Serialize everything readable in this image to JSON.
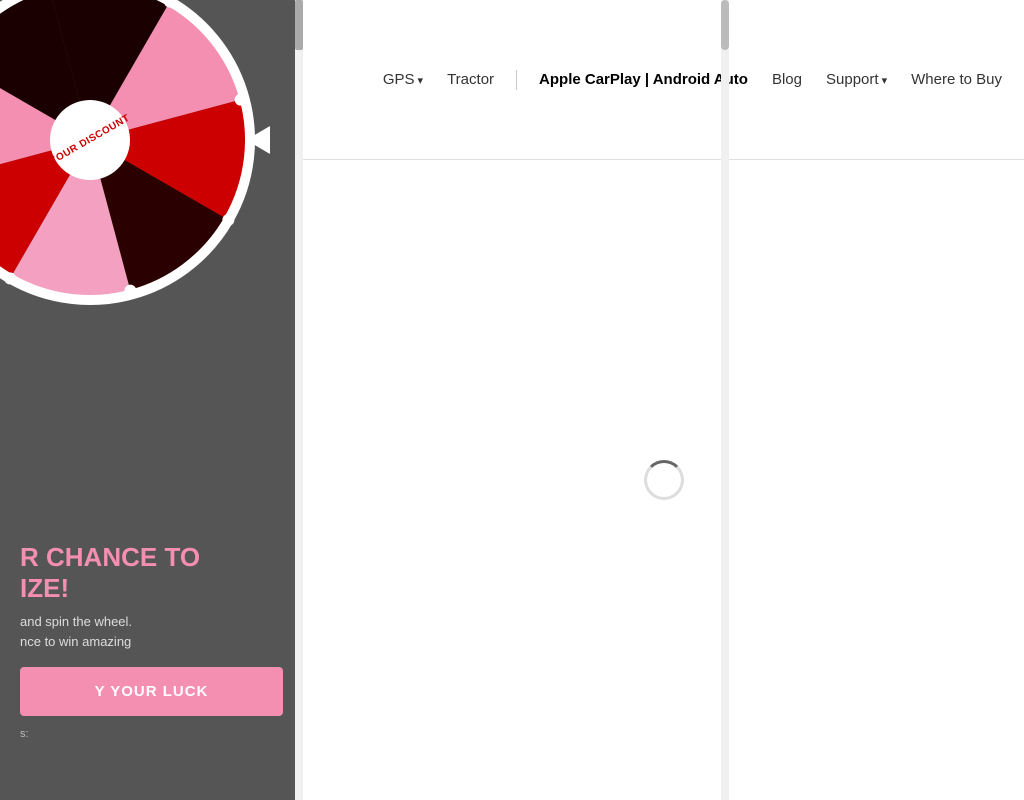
{
  "header": {
    "nav_items": [
      {
        "label": "GPS",
        "dropdown": true,
        "active": false
      },
      {
        "label": "Tractor",
        "dropdown": false,
        "active": false
      },
      {
        "label": "Apple CarPlay | Android Auto",
        "dropdown": false,
        "active": true
      },
      {
        "label": "Blog",
        "dropdown": false,
        "active": false
      },
      {
        "label": "Support",
        "dropdown": true,
        "active": false
      },
      {
        "label": "Where to Buy",
        "dropdown": false,
        "active": false
      }
    ]
  },
  "popup": {
    "wheel_label": "YOUR DISCOUNT",
    "heading_line1": "R CHANCE TO",
    "heading_highlight": "IZE",
    "heading_suffix": "!",
    "subtext_line1": "and spin the wheel.",
    "subtext_line2": "nce to win amazing",
    "button_label": "Y YOUR LUCK",
    "footer_text": "s:"
  },
  "wheel": {
    "segments": [
      {
        "color": "#1a0000",
        "angle": 0
      },
      {
        "color": "#f48fb1",
        "angle": 45
      },
      {
        "color": "#cc0000",
        "angle": 90
      },
      {
        "color": "#1a0000",
        "angle": 135
      },
      {
        "color": "#f48fb1",
        "angle": 180
      },
      {
        "color": "#cc0000",
        "angle": 225
      },
      {
        "color": "#f48fb1",
        "angle": 270
      },
      {
        "color": "#1a0000",
        "angle": 315
      }
    ]
  }
}
